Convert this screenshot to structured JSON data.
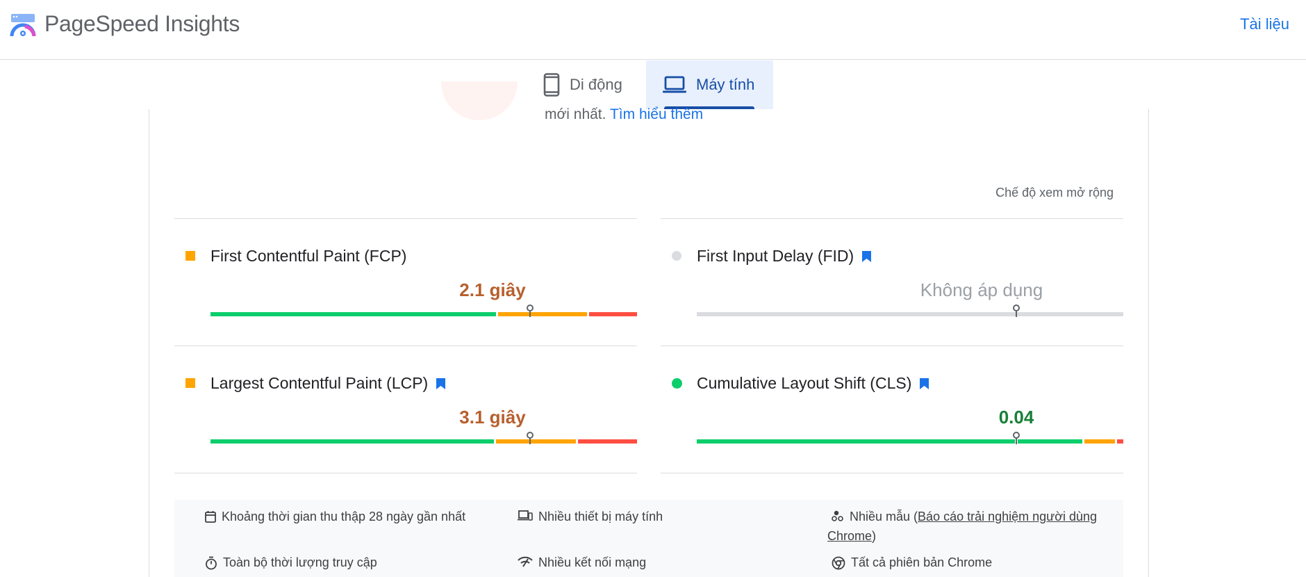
{
  "header": {
    "app_title": "PageSpeed Insights",
    "docs_label": "Tài liệu"
  },
  "tabs": [
    {
      "label": "Di động",
      "active": false
    },
    {
      "label": "Máy tính",
      "active": true
    }
  ],
  "intro": {
    "text": "mới nhất.",
    "learn_more": "Tìm hiểu thêm"
  },
  "expand_view_label": "Chế độ xem mở rộng",
  "metrics": [
    {
      "name": "First Contentful Paint (FCP)",
      "value": "2.1 giây",
      "status": "average",
      "bookmark": false
    },
    {
      "name": "First Input Delay (FID)",
      "value": "Không áp dụng",
      "status": "none",
      "bookmark": true
    },
    {
      "name": "Largest Contentful Paint (LCP)",
      "value": "3.1 giây",
      "status": "average",
      "bookmark": true
    },
    {
      "name": "Cumulative Layout Shift (CLS)",
      "value": "0.04",
      "status": "good",
      "bookmark": true
    }
  ],
  "footer": {
    "collection_period": "Khoảng thời gian thu thập 28 ngày gần nhất",
    "devices": "Nhiều thiết bị máy tính",
    "samples_prefix": "Nhiều mẫu (",
    "samples_link": "Báo cáo trải nghiệm người dùng Chrome",
    "samples_suffix": ")",
    "duration": "Toàn bộ thời lượng truy cập",
    "network": "Nhiều kết nối mạng",
    "chrome_versions": "Tất cả phiên bản Chrome"
  },
  "colors": {
    "good": "#0cce6b",
    "average": "#ffa400",
    "poor": "#ff4e42",
    "link": "#1a73e8",
    "active_tab": "#174ea6"
  }
}
